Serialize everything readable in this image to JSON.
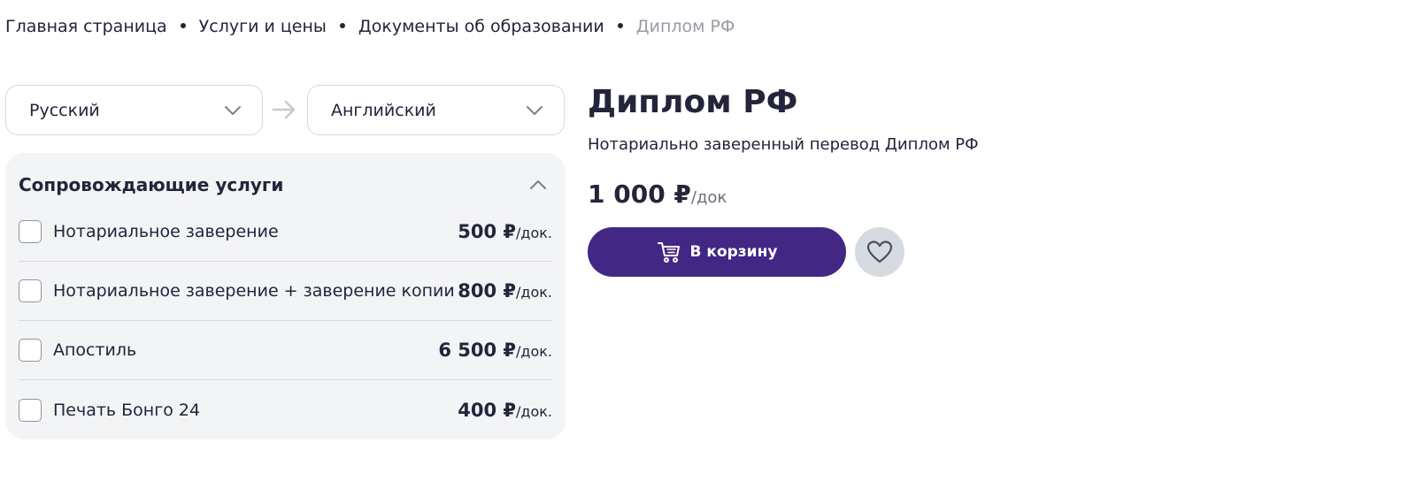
{
  "breadcrumb": {
    "items": [
      "Главная страница",
      "Услуги и цены",
      "Документы об образовании"
    ],
    "current": "Диплом РФ"
  },
  "language": {
    "from": "Русский",
    "to": "Английский"
  },
  "services": {
    "title": "Сопровождающие услуги",
    "items": [
      {
        "label": "Нотариальное заверение",
        "price": "500 ₽",
        "unit": "/док."
      },
      {
        "label": "Нотариальное заверение + заверение копии",
        "price": "800 ₽",
        "unit": "/док."
      },
      {
        "label": "Апостиль",
        "price": "6 500 ₽",
        "unit": "/док."
      },
      {
        "label": "Печать Бонго 24",
        "price": "400 ₽",
        "unit": "/док."
      }
    ]
  },
  "product": {
    "title": "Диплом РФ",
    "subtitle": "Нотариально заверенный перевод Диплом РФ",
    "price": "1 000 ₽",
    "price_unit": "/док"
  },
  "actions": {
    "cart_label": "В корзину",
    "cart_icon": "cart-icon",
    "favorite_icon": "heart-icon"
  },
  "colors": {
    "accent": "#432785",
    "card_bg": "#f3f4f6",
    "fav_bg": "#d5dbe1"
  }
}
